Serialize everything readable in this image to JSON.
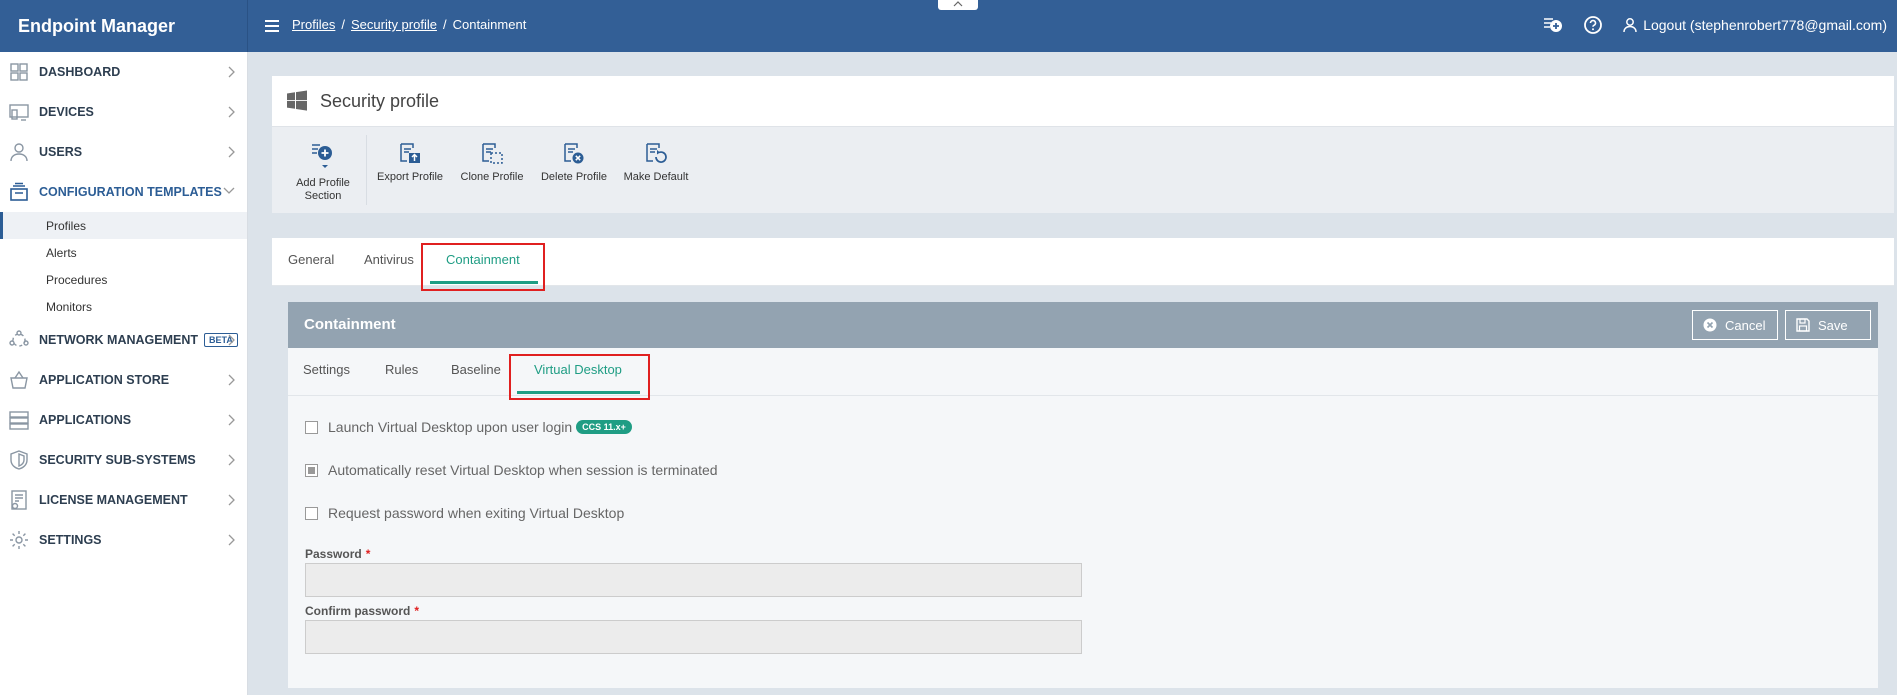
{
  "app": {
    "title": "Endpoint Manager"
  },
  "breadcrumb": {
    "profiles": "Profiles",
    "separator": "/",
    "security_profile": "Security profile",
    "current": "Containment"
  },
  "topbar": {
    "logout_label": "Logout (stephenrobert778@gmail.com)",
    "icons": [
      "add-notification-icon",
      "help-icon",
      "user-icon"
    ]
  },
  "sidebar": {
    "items": [
      {
        "label": "DASHBOARD",
        "icon": "dashboard-icon"
      },
      {
        "label": "DEVICES",
        "icon": "devices-icon"
      },
      {
        "label": "USERS",
        "icon": "user-icon"
      },
      {
        "label": "CONFIGURATION TEMPLATES",
        "icon": "templates-icon"
      },
      {
        "label": "NETWORK MANAGEMENT",
        "icon": "network-icon",
        "badge": "BETA"
      },
      {
        "label": "APPLICATION STORE",
        "icon": "basket-icon"
      },
      {
        "label": "APPLICATIONS",
        "icon": "applications-icon"
      },
      {
        "label": "SECURITY SUB-SYSTEMS",
        "icon": "shield-icon"
      },
      {
        "label": "LICENSE MANAGEMENT",
        "icon": "license-icon"
      },
      {
        "label": "SETTINGS",
        "icon": "gear-icon"
      }
    ],
    "sub_items": [
      "Profiles",
      "Alerts",
      "Procedures",
      "Monitors"
    ]
  },
  "panel": {
    "title": "Security profile",
    "icon": "windows-icon"
  },
  "toolbar": {
    "add_section_line1": "Add Profile",
    "add_section_line2": "Section",
    "export": "Export Profile",
    "clone": "Clone Profile",
    "delete": "Delete Profile",
    "make_default": "Make Default"
  },
  "tabs": {
    "general": "General",
    "antivirus": "Antivirus",
    "containment": "Containment"
  },
  "containment": {
    "title": "Containment",
    "cancel": "Cancel",
    "save": "Save",
    "subtabs": {
      "settings": "Settings",
      "rules": "Rules",
      "baseline": "Baseline",
      "virtual_desktop": "Virtual Desktop"
    },
    "options": {
      "launch": {
        "label": "Launch Virtual Desktop upon user login",
        "checked": false,
        "badge": "CCS 11.x+"
      },
      "reset": {
        "label": "Automatically reset Virtual Desktop when session is terminated",
        "checked": true
      },
      "request_password": {
        "label": "Request password when exiting Virtual Desktop",
        "checked": false
      }
    },
    "password_label": "Password",
    "confirm_password_label": "Confirm password",
    "required_mark": "*",
    "password_value": "",
    "confirm_password_value": ""
  },
  "colors": {
    "topbar": "#335f96",
    "accent": "#1f9d84",
    "highlight": "#e02020",
    "bar": "#93a3b1"
  }
}
